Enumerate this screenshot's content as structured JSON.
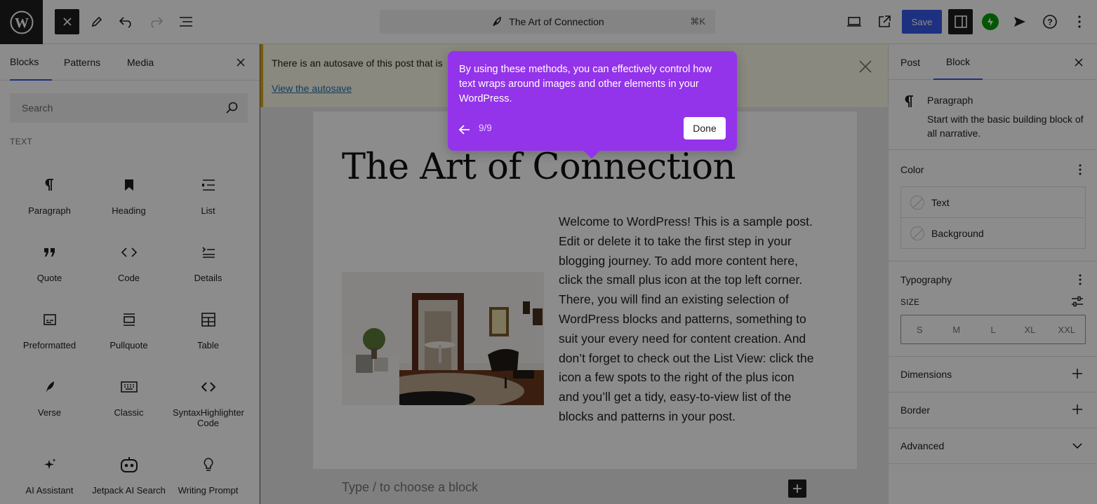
{
  "topbar": {
    "doc_title": "The Art of Connection",
    "shortcut": "⌘K",
    "save_label": "Save"
  },
  "inserter": {
    "tabs": [
      "Blocks",
      "Patterns",
      "Media"
    ],
    "search_placeholder": "Search",
    "category": "TEXT",
    "blocks": [
      {
        "label": "Paragraph",
        "icon": "paragraph-icon"
      },
      {
        "label": "Heading",
        "icon": "heading-icon"
      },
      {
        "label": "List",
        "icon": "list-icon"
      },
      {
        "label": "Quote",
        "icon": "quote-icon"
      },
      {
        "label": "Code",
        "icon": "code-icon"
      },
      {
        "label": "Details",
        "icon": "details-icon"
      },
      {
        "label": "Preformatted",
        "icon": "preformatted-icon"
      },
      {
        "label": "Pullquote",
        "icon": "pullquote-icon"
      },
      {
        "label": "Table",
        "icon": "table-icon"
      },
      {
        "label": "Verse",
        "icon": "verse-icon"
      },
      {
        "label": "Classic",
        "icon": "classic-icon"
      },
      {
        "label": "SyntaxHighlighter Code",
        "icon": "syntax-code-icon"
      },
      {
        "label": "AI Assistant",
        "icon": "ai-assistant-icon"
      },
      {
        "label": "Jetpack AI Search",
        "icon": "jetpack-ai-search-icon"
      },
      {
        "label": "Writing Prompt",
        "icon": "writing-prompt-icon"
      }
    ]
  },
  "notice": {
    "text": "There is an autosave of this post that is",
    "link": "View the autosave"
  },
  "post": {
    "title": "The Art of Connection",
    "body": "Welcome to WordPress! This is a sample post. Edit or delete it to take the first step in your blogging journey. To add more content here, click the small plus icon at the top left corner. There, you will find an existing selection of WordPress blocks and patterns, something to suit your every need for content creation. And don’t forget to check out the List View: click the icon a few spots to the right of the plus icon and you’ll get a tidy, easy-to-view list of the blocks and patterns in your post.",
    "appender_placeholder": "Type / to choose a block"
  },
  "settings": {
    "tabs": [
      "Post",
      "Block"
    ],
    "block_title": "Paragraph",
    "block_desc": "Start with the basic building block of all narrative.",
    "color_title": "Color",
    "color_rows": [
      "Text",
      "Background"
    ],
    "typography_title": "Typography",
    "size_label": "SIZE",
    "sizes": [
      "S",
      "M",
      "L",
      "XL",
      "XXL"
    ],
    "dimensions_title": "Dimensions",
    "border_title": "Border",
    "advanced_title": "Advanced"
  },
  "tour": {
    "text": "By using these methods, you can effectively control how text wraps around images and other elements in your WordPress.",
    "step": "9/9",
    "done_label": "Done",
    "color": "#9333ea"
  }
}
